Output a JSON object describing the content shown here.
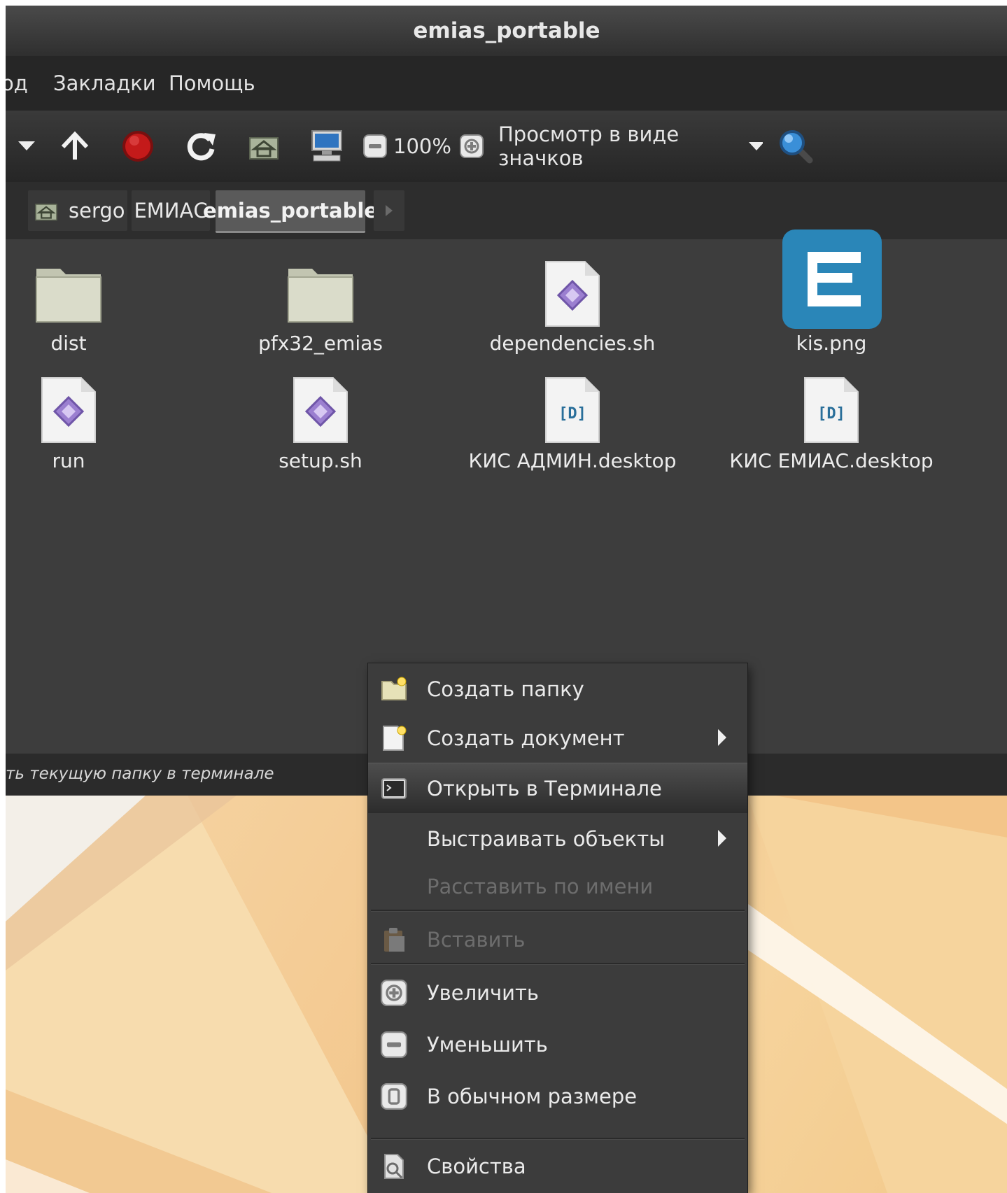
{
  "window": {
    "title": "emias_portable"
  },
  "menubar": {
    "items": [
      "од",
      "Закладки",
      "Помощь"
    ]
  },
  "toolbar": {
    "zoom": "100%",
    "view_mode": "Просмотр в виде значков"
  },
  "pathbar": {
    "crumbs": [
      "sergo",
      "ЕМИАС",
      "emias_portable"
    ]
  },
  "files": [
    {
      "name": "dist",
      "icon": "folder-icon"
    },
    {
      "name": "pfx32_emias",
      "icon": "folder-icon"
    },
    {
      "name": "dependencies.sh",
      "icon": "script-icon"
    },
    {
      "name": "kis.png",
      "icon": "image-icon"
    },
    {
      "name": "run",
      "icon": "script-icon"
    },
    {
      "name": "setup.sh",
      "icon": "script-icon"
    },
    {
      "name": "КИС АДМИН.desktop",
      "icon": "desktop-file-icon"
    },
    {
      "name": "КИС ЕМИАС.desktop",
      "icon": "desktop-file-icon"
    }
  ],
  "statusbar": {
    "text": "ть текущую папку в терминале"
  },
  "context_menu": {
    "items": [
      {
        "label": "Создать папку",
        "icon": "new-folder-icon",
        "submenu": false,
        "disabled": false
      },
      {
        "label": "Создать документ",
        "icon": "new-document-icon",
        "submenu": true,
        "disabled": false
      },
      {
        "label": "Открыть в Терминале",
        "icon": "terminal-icon",
        "submenu": false,
        "disabled": false,
        "highlighted": true
      },
      {
        "label": "Выстраивать объекты",
        "icon": "",
        "submenu": true,
        "disabled": false
      },
      {
        "label": "Расставить по имени",
        "icon": "",
        "submenu": false,
        "disabled": true
      },
      {
        "label": "Вставить",
        "icon": "paste-icon",
        "submenu": false,
        "disabled": true
      },
      {
        "label": "Увеличить",
        "icon": "zoom-in-icon",
        "submenu": false,
        "disabled": false
      },
      {
        "label": "Уменьшить",
        "icon": "zoom-out-icon",
        "submenu": false,
        "disabled": false
      },
      {
        "label": "В обычном размере",
        "icon": "zoom-normal-icon",
        "submenu": false,
        "disabled": false
      },
      {
        "label": "Свойства",
        "icon": "properties-icon",
        "submenu": false,
        "disabled": false
      }
    ]
  },
  "colors": {
    "accent_blue": "#2a86b8",
    "script_purple": "#9b7fd0",
    "stop_red": "#c41a1a"
  }
}
